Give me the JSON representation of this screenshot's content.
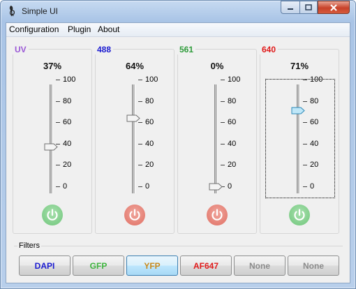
{
  "window": {
    "title": "Simple UI"
  },
  "menu": [
    "Configuration",
    "Plugin",
    "About"
  ],
  "ticks": [
    "100",
    "80",
    "60",
    "40",
    "20",
    "0"
  ],
  "channels": [
    {
      "label": "UV",
      "color": "#9b59d6",
      "percent_text": "37%",
      "level": 37,
      "power": "on"
    },
    {
      "label": "488",
      "color": "#1a1ad0",
      "percent_text": "64%",
      "level": 64,
      "power": "off"
    },
    {
      "label": "561",
      "color": "#2e9b3a",
      "percent_text": "0%",
      "level": 0,
      "power": "off"
    },
    {
      "label": "640",
      "color": "#e01a1a",
      "percent_text": "71%",
      "level": 71,
      "power": "on"
    }
  ],
  "filters": {
    "label": "Filters",
    "buttons": [
      {
        "label": "DAPI",
        "color": "#1a1ad0",
        "selected": false
      },
      {
        "label": "GFP",
        "color": "#3cb43c",
        "selected": false
      },
      {
        "label": "YFP",
        "color": "#c8881a",
        "selected": true
      },
      {
        "label": "AF647",
        "color": "#e01a1a",
        "selected": false
      },
      {
        "label": "None",
        "color": "#8a8a8a",
        "selected": false
      },
      {
        "label": "None",
        "color": "#8a8a8a",
        "selected": false
      }
    ]
  }
}
